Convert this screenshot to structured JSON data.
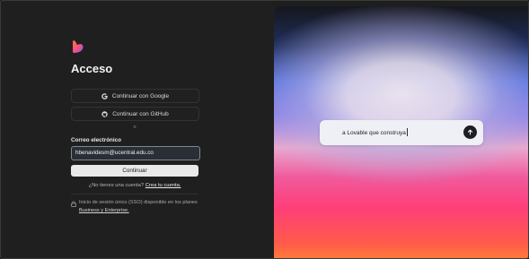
{
  "auth": {
    "title": "Acceso",
    "google_label": "Continuar con Google",
    "github_label": "Continuar con GitHub",
    "separator": "o",
    "email_label": "Correo electrónico",
    "email_value": "hbenavidesm@ucentral.edu.co",
    "continue_label": "Continuar",
    "signup_prompt": "¿No tienes una cuenta?",
    "signup_link": "Crea tu cuenta.",
    "sso_text": "Inicio de sesión único (SSO) disponible en los planes",
    "sso_link": "Business y Enterprise."
  },
  "prompt": {
    "text": "a Lovable que construya"
  },
  "icons": {
    "logo": "lovable-heart-logo",
    "google": "google-icon",
    "github": "github-icon",
    "lock": "lock-icon",
    "send": "arrow-up-icon"
  },
  "colors": {
    "background": "#1f1f1f",
    "primary_button": "#e9e9e9",
    "field_border": "#7d8796"
  }
}
